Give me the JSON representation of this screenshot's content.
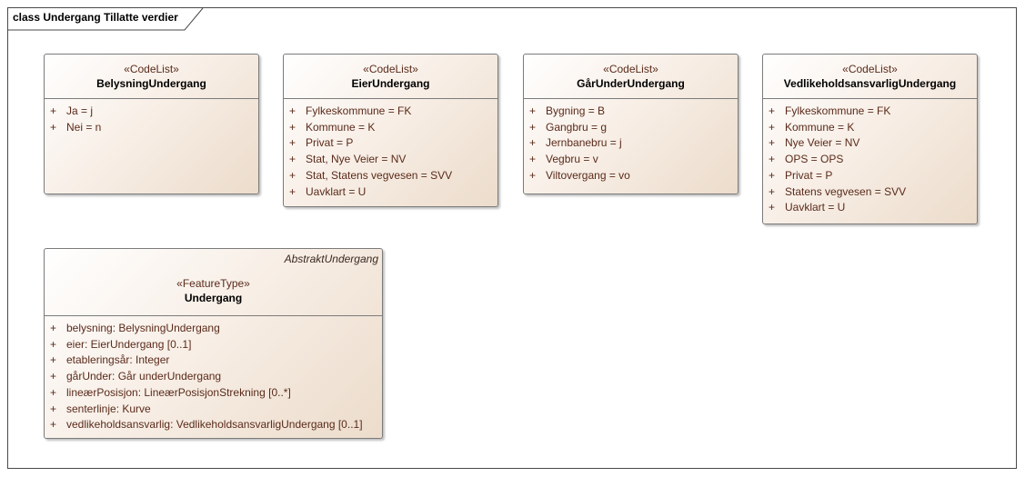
{
  "frame": {
    "title": "class Undergang Tillatte verdier"
  },
  "classes": [
    {
      "stereotype": "«CodeList»",
      "name": "BelysningUndergang",
      "attributes": [
        {
          "vis": "+",
          "text": "Ja = j"
        },
        {
          "vis": "+",
          "text": "Nei = n"
        }
      ]
    },
    {
      "stereotype": "«CodeList»",
      "name": "EierUndergang",
      "attributes": [
        {
          "vis": "+",
          "text": "Fylkeskommune = FK"
        },
        {
          "vis": "+",
          "text": "Kommune = K"
        },
        {
          "vis": "+",
          "text": "Privat = P"
        },
        {
          "vis": "+",
          "text": "Stat, Nye Veier = NV"
        },
        {
          "vis": "+",
          "text": "Stat, Statens vegvesen = SVV"
        },
        {
          "vis": "+",
          "text": "Uavklart = U"
        }
      ]
    },
    {
      "stereotype": "«CodeList»",
      "name": "GårUnderUndergang",
      "attributes": [
        {
          "vis": "+",
          "text": "Bygning = B"
        },
        {
          "vis": "+",
          "text": "Gangbru = g"
        },
        {
          "vis": "+",
          "text": "Jernbanebru = j"
        },
        {
          "vis": "+",
          "text": "Vegbru = v"
        },
        {
          "vis": "+",
          "text": "Viltovergang = vo"
        }
      ]
    },
    {
      "stereotype": "«CodeList»",
      "name": "VedlikeholdsansvarligUndergang",
      "attributes": [
        {
          "vis": "+",
          "text": "Fylkeskommune = FK"
        },
        {
          "vis": "+",
          "text": "Kommune = K"
        },
        {
          "vis": "+",
          "text": "Nye Veier = NV"
        },
        {
          "vis": "+",
          "text": "OPS = OPS"
        },
        {
          "vis": "+",
          "text": "Privat = P"
        },
        {
          "vis": "+",
          "text": "Statens vegvesen = SVV"
        },
        {
          "vis": "+",
          "text": "Uavklart = U"
        }
      ]
    },
    {
      "superclass": "AbstraktUndergang",
      "stereotype": "«FeatureType»",
      "name": "Undergang",
      "attributes": [
        {
          "vis": "+",
          "text": "belysning: BelysningUndergang"
        },
        {
          "vis": "+",
          "text": "eier: EierUndergang [0..1]"
        },
        {
          "vis": "+",
          "text": "etableringsår: Integer"
        },
        {
          "vis": "+",
          "text": "gårUnder: Går underUndergang"
        },
        {
          "vis": "+",
          "text": "lineærPosisjon: LineærPosisjonStrekning [0..*]"
        },
        {
          "vis": "+",
          "text": "senterlinje: Kurve"
        },
        {
          "vis": "+",
          "text": "vedlikeholdsansvarlig: VedlikeholdsansvarligUndergang [0..1]"
        }
      ]
    }
  ]
}
